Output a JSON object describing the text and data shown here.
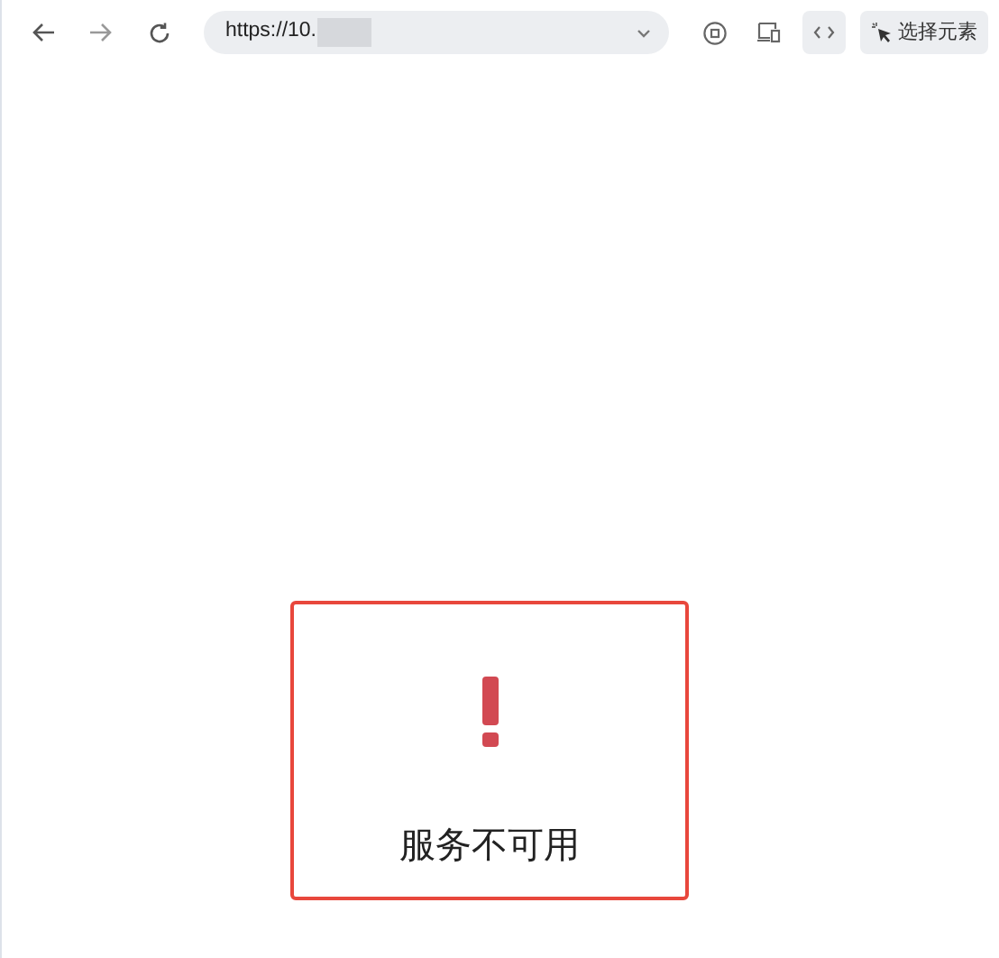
{
  "toolbar": {
    "address": "https://10.",
    "select_element_button": "选择元素"
  },
  "error_card": {
    "message": "服务不可用"
  }
}
